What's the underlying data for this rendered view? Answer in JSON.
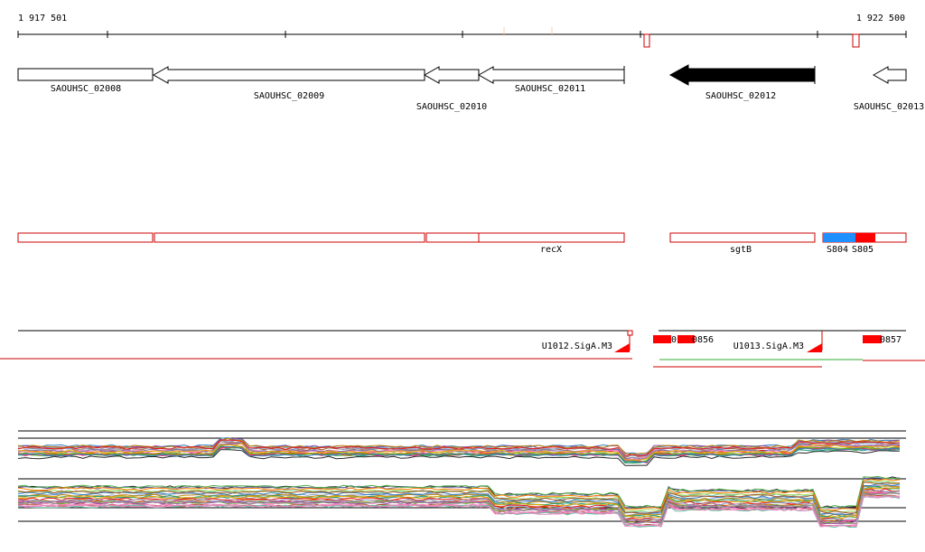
{
  "coords": {
    "start": "1 917 501",
    "end": "1 922 500"
  },
  "genes": [
    {
      "label": "SAOUHSC_02008",
      "selected": false
    },
    {
      "label": "SAOUHSC_02009",
      "selected": false
    },
    {
      "label": "SAOUHSC_02010",
      "selected": false
    },
    {
      "label": "SAOUHSC_02011",
      "selected": false
    },
    {
      "label": "SAOUHSC_02012",
      "selected": true
    },
    {
      "label": "SAOUHSC_02013",
      "selected": false
    }
  ],
  "annotations": [
    {
      "label": ""
    },
    {
      "label": ""
    },
    {
      "label": ""
    },
    {
      "label": "recX"
    },
    {
      "label": "sgtB"
    }
  ],
  "segments": [
    {
      "label": "S804",
      "color": "#1e90ff"
    },
    {
      "label": "S805",
      "color": "#ff0000"
    }
  ],
  "transcripts": {
    "u1012": "U1012.SigA.M3",
    "u1013": "U1013.SigA.M3",
    "r0856_a": "0",
    "r0856_b": "0856",
    "r0857": "0857"
  },
  "colors": {
    "feature_outline": "#cc0000",
    "feature_fill": "#ff0000",
    "selected_gene": "#000000",
    "green_track": "#33aa33"
  }
}
